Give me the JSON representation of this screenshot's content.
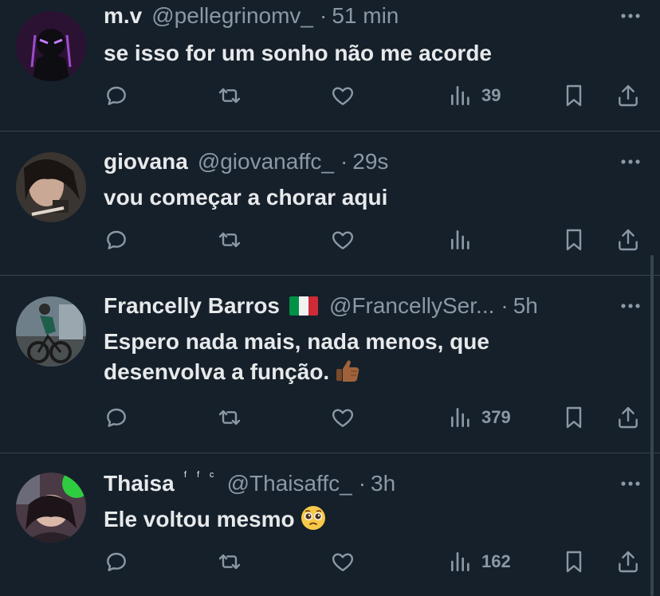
{
  "tweets": [
    {
      "name": "m.v",
      "handle": "@pellegrinomv_",
      "separator": "·",
      "time": "51 min",
      "text": "se isso for um sonho não me acorde",
      "views": "39",
      "avatar_color": "#2b1233"
    },
    {
      "name": "giovana",
      "handle": "@giovanaffc_",
      "separator": "·",
      "time": "29s",
      "text": "vou começar a chorar aqui",
      "views": "",
      "avatar_color": "#3a3530"
    },
    {
      "name": "Francelly Barros",
      "handle": "@FrancellySer...",
      "separator": "·",
      "time": "5h",
      "text_line1": "Espero nada mais, nada menos, que",
      "text_line2": "desenvolva a função.",
      "views": "379",
      "avatar_color": "#6f7f8a"
    },
    {
      "name": "Thaisa",
      "badge": "ᶠ ᶠ ᶜ",
      "handle": "@Thaisaffc_",
      "separator": "·",
      "time": "3h",
      "text": "Ele voltou mesmo",
      "views": "162",
      "avatar_color": "#4a3a45"
    }
  ],
  "colors": {
    "background": "#15202b",
    "text": "#e7e9ea",
    "muted": "#8b98a5",
    "divider": "#38444d"
  },
  "icons": {
    "reply": "reply-icon",
    "retweet": "retweet-icon",
    "like": "heart-icon",
    "views": "views-icon",
    "bookmark": "bookmark-icon",
    "share": "share-icon",
    "more": "more-icon"
  }
}
